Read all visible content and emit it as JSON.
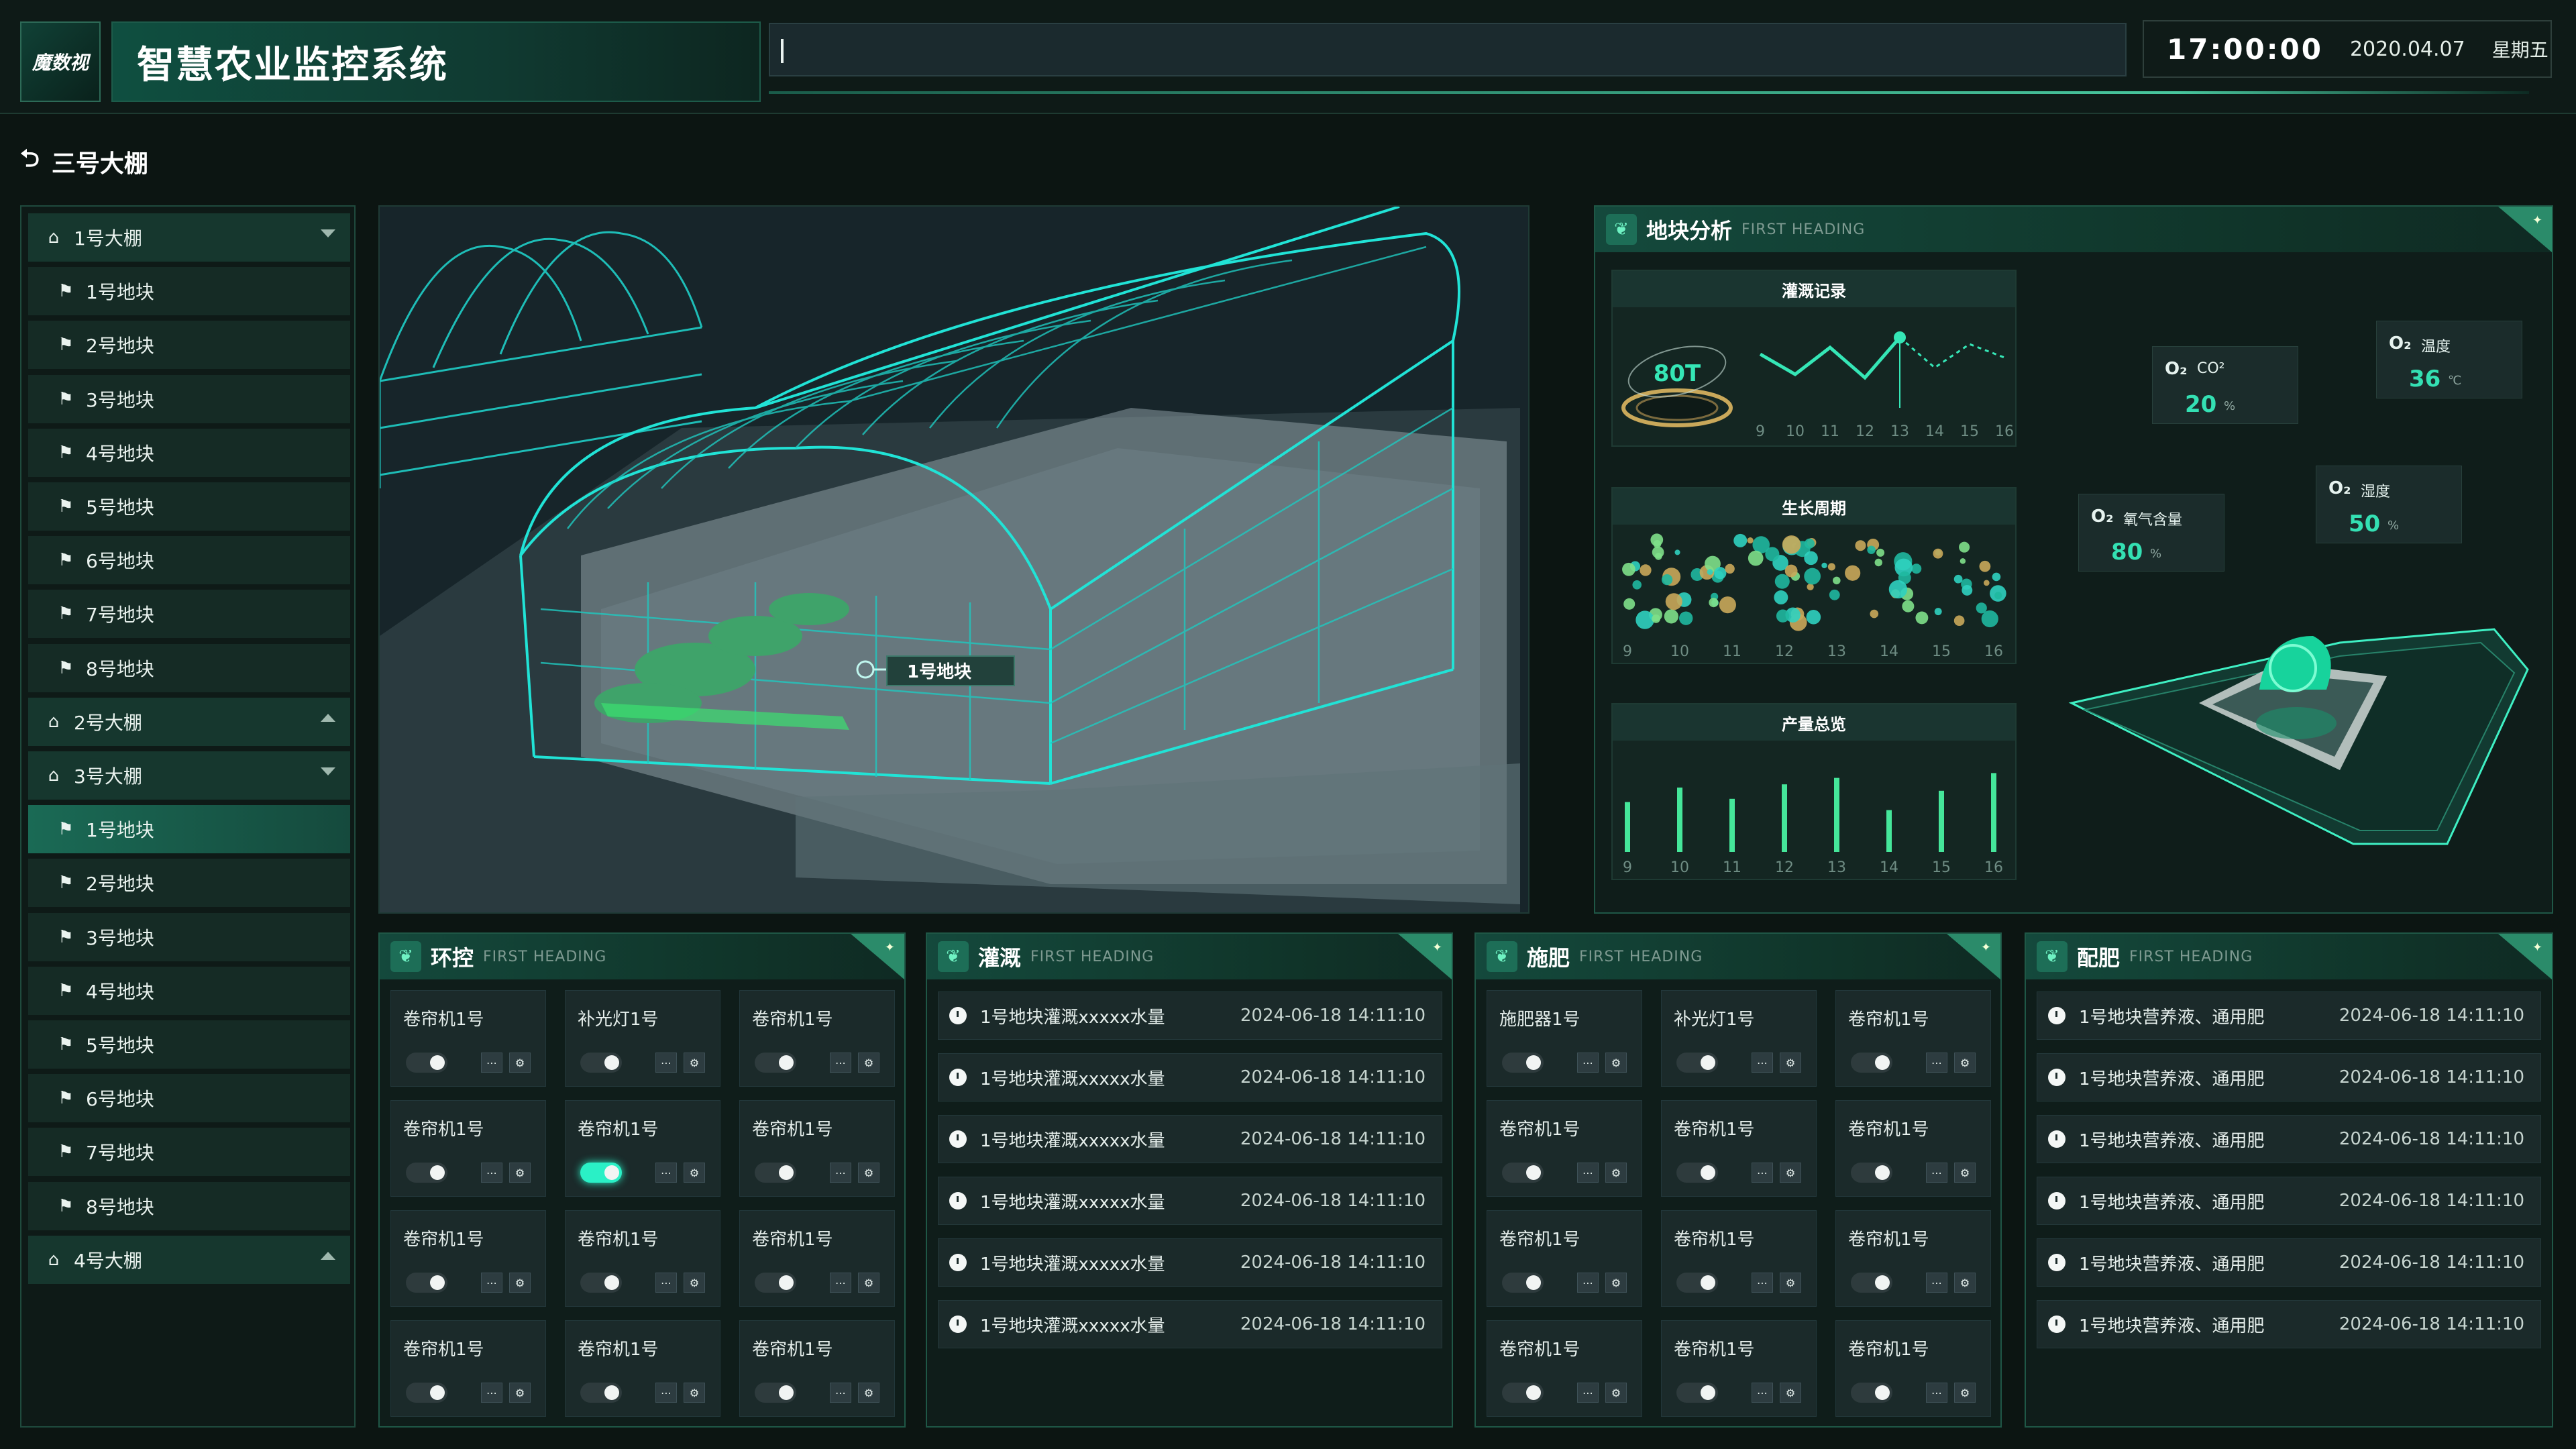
{
  "header": {
    "logo_text": "魔数视",
    "title": "智慧农业监控系统",
    "time": "17:00:00",
    "date": "2020.04.07",
    "weekday": "星期五"
  },
  "breadcrumb": {
    "label": "三号大棚"
  },
  "sidebar": {
    "items": [
      {
        "label": "1号大棚",
        "type": "group",
        "expanded": true
      },
      {
        "label": "1号地块",
        "type": "plot"
      },
      {
        "label": "2号地块",
        "type": "plot"
      },
      {
        "label": "3号地块",
        "type": "plot"
      },
      {
        "label": "4号地块",
        "type": "plot"
      },
      {
        "label": "5号地块",
        "type": "plot"
      },
      {
        "label": "6号地块",
        "type": "plot"
      },
      {
        "label": "7号地块",
        "type": "plot"
      },
      {
        "label": "8号地块",
        "type": "plot"
      },
      {
        "label": "2号大棚",
        "type": "group",
        "expanded": false
      },
      {
        "label": "3号大棚",
        "type": "group",
        "expanded": true
      },
      {
        "label": "1号地块",
        "type": "plot",
        "active": true
      },
      {
        "label": "2号地块",
        "type": "plot"
      },
      {
        "label": "3号地块",
        "type": "plot"
      },
      {
        "label": "4号地块",
        "type": "plot"
      },
      {
        "label": "5号地块",
        "type": "plot"
      },
      {
        "label": "6号地块",
        "type": "plot"
      },
      {
        "label": "7号地块",
        "type": "plot"
      },
      {
        "label": "8号地块",
        "type": "plot"
      },
      {
        "label": "4号大棚",
        "type": "group",
        "expanded": false
      }
    ]
  },
  "scene": {
    "plot_label": "1号地块"
  },
  "analysis": {
    "title": "地块分析",
    "subtitle": "FIRST HEADING",
    "irrigation": {
      "title": "灌溉记录",
      "gauge_label": "80T"
    },
    "growth": {
      "title": "生长周期"
    },
    "yield": {
      "title": "产量总览"
    },
    "metrics": {
      "co2": {
        "icon": "O₂",
        "label": "CO²",
        "value": "20",
        "unit": "%"
      },
      "temp": {
        "icon": "O₂",
        "label": "温度",
        "value": "36",
        "unit": "℃"
      },
      "oxygen": {
        "icon": "O₂",
        "label": "氧气含量",
        "value": "80",
        "unit": "%"
      },
      "humidity": {
        "icon": "O₂",
        "label": "湿度",
        "value": "50",
        "unit": "%"
      }
    }
  },
  "chart_data": [
    {
      "type": "line",
      "title": "灌溉记录",
      "x": [
        9,
        10,
        11,
        12,
        13,
        14,
        15,
        16
      ],
      "values": [
        60,
        30,
        70,
        25,
        85,
        40,
        75,
        55
      ]
    },
    {
      "type": "scatter",
      "title": "生长周期",
      "x": [
        9,
        10,
        11,
        12,
        13,
        14,
        15,
        16
      ]
    },
    {
      "type": "bar",
      "title": "产量总览",
      "categories": [
        "9",
        "10",
        "11",
        "12",
        "13",
        "14",
        "15",
        "16"
      ],
      "values": [
        0.62,
        0.8,
        0.66,
        0.84,
        0.92,
        0.52,
        0.76,
        0.98
      ]
    }
  ],
  "env": {
    "title": "环控",
    "subtitle": "FIRST HEADING",
    "cards": [
      {
        "label": "卷帘机1号",
        "on": false
      },
      {
        "label": "补光灯1号",
        "on": false
      },
      {
        "label": "卷帘机1号",
        "on": false
      },
      {
        "label": "卷帘机1号",
        "on": false
      },
      {
        "label": "卷帘机1号",
        "on": true
      },
      {
        "label": "卷帘机1号",
        "on": false
      },
      {
        "label": "卷帘机1号",
        "on": false
      },
      {
        "label": "卷帘机1号",
        "on": false
      },
      {
        "label": "卷帘机1号",
        "on": false
      },
      {
        "label": "卷帘机1号",
        "on": false
      },
      {
        "label": "卷帘机1号",
        "on": false
      },
      {
        "label": "卷帘机1号",
        "on": false
      }
    ]
  },
  "irrigate": {
    "title": "灌溉",
    "subtitle": "FIRST HEADING",
    "rows": [
      {
        "text": "1号地块灌溉xxxxx水量",
        "time": "2024-06-18 14:11:10"
      },
      {
        "text": "1号地块灌溉xxxxx水量",
        "time": "2024-06-18 14:11:10"
      },
      {
        "text": "1号地块灌溉xxxxx水量",
        "time": "2024-06-18 14:11:10"
      },
      {
        "text": "1号地块灌溉xxxxx水量",
        "time": "2024-06-18 14:11:10"
      },
      {
        "text": "1号地块灌溉xxxxx水量",
        "time": "2024-06-18 14:11:10"
      },
      {
        "text": "1号地块灌溉xxxxx水量",
        "time": "2024-06-18 14:11:10"
      }
    ]
  },
  "fert": {
    "title": "施肥",
    "subtitle": "FIRST HEADING",
    "cards": [
      {
        "label": "施肥器1号",
        "on": false
      },
      {
        "label": "补光灯1号",
        "on": false
      },
      {
        "label": "卷帘机1号",
        "on": false
      },
      {
        "label": "卷帘机1号",
        "on": false
      },
      {
        "label": "卷帘机1号",
        "on": false
      },
      {
        "label": "卷帘机1号",
        "on": false
      },
      {
        "label": "卷帘机1号",
        "on": false
      },
      {
        "label": "卷帘机1号",
        "on": false
      },
      {
        "label": "卷帘机1号",
        "on": false
      },
      {
        "label": "卷帘机1号",
        "on": false
      },
      {
        "label": "卷帘机1号",
        "on": false
      },
      {
        "label": "卷帘机1号",
        "on": false
      }
    ]
  },
  "mix": {
    "title": "配肥",
    "subtitle": "FIRST HEADING",
    "rows": [
      {
        "text": "1号地块营养液、通用肥",
        "time": "2024-06-18 14:11:10"
      },
      {
        "text": "1号地块营养液、通用肥",
        "time": "2024-06-18 14:11:10"
      },
      {
        "text": "1号地块营养液、通用肥",
        "time": "2024-06-18 14:11:10"
      },
      {
        "text": "1号地块营养液、通用肥",
        "time": "2024-06-18 14:11:10"
      },
      {
        "text": "1号地块营养液、通用肥",
        "time": "2024-06-18 14:11:10"
      },
      {
        "text": "1号地块营养液、通用肥",
        "time": "2024-06-18 14:11:10"
      }
    ]
  },
  "colors": {
    "accent": "#2af0c6",
    "panel_border": "#1f5746",
    "gold": "#c9a85a",
    "teal": "#1fb8a0",
    "green": "#7ee08a"
  }
}
